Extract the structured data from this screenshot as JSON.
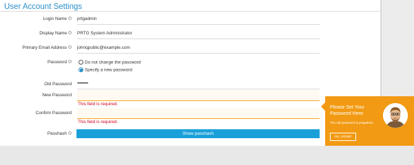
{
  "page": {
    "title": "User Account Settings"
  },
  "fields": {
    "login_name": {
      "label": "Login Name",
      "value": "prtgadmin"
    },
    "display_name": {
      "label": "Display Name",
      "value": "PRTG System Administrator"
    },
    "email": {
      "label": "Primary Email Address",
      "value": "johnqpublic@example.com"
    },
    "password": {
      "label": "Password",
      "options": [
        "Do not change the password",
        "Specify a new password"
      ],
      "selected": "Specify a new password"
    },
    "old_password": {
      "label": "Old Password",
      "value": "•••••••••"
    },
    "new_password": {
      "label": "New Password",
      "value": "",
      "error": "This field is required."
    },
    "confirm_password": {
      "label": "Confirm Password",
      "value": "",
      "error": "This field is required."
    },
    "passhash": {
      "label": "Passhash",
      "button": "Show passhash"
    }
  },
  "help_icon": "info-circle-icon",
  "tooltip": {
    "title": "Please Set Your Password Here.",
    "note": "The old password is prtgadmin.",
    "button": "OK, DONE!",
    "color": "#f29a13"
  },
  "colors": {
    "accent": "#2a8fc9",
    "button": "#1aa0d9",
    "error": "#d0021b",
    "warning_line": "#f5a623"
  }
}
